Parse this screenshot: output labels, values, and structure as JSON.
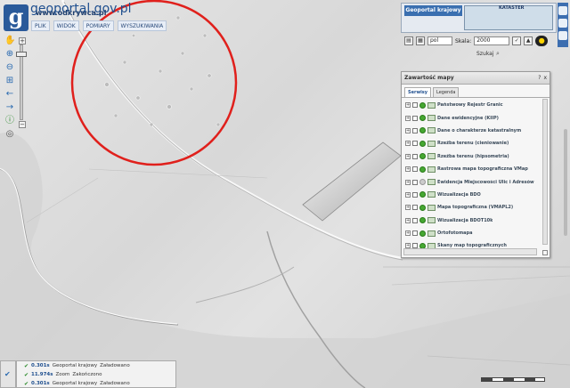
{
  "header": {
    "logo_letter": "g",
    "logo_text": "geoportal.gov.pl",
    "url_overlay": "www.odkrywca.pl",
    "portal_title": "Geoportal krajowy",
    "minimap_label": "KATASTER"
  },
  "menu": [
    "PLIK",
    "WIDOK",
    "POMIARY",
    "WYSZUKIWANIA"
  ],
  "toolbar": {
    "unit_value": "pol",
    "scale_label": "Skala:",
    "scale_value": "2000"
  },
  "search": {
    "label": "Szukaj"
  },
  "layers_panel": {
    "title": "Zawartość mapy",
    "header_buttons": [
      "?",
      "x"
    ],
    "tabs": [
      {
        "label": "Serwisy",
        "active": true
      },
      {
        "label": "Legenda",
        "active": false
      }
    ],
    "items": [
      {
        "label": "Państwowy Rejestr Granic",
        "visible": true
      },
      {
        "label": "Dane ewidencyjne (KIIP)",
        "visible": true
      },
      {
        "label": "Dane o charakterze katastralnym",
        "visible": true
      },
      {
        "label": "Rzeźba terenu (cieniowanie)",
        "visible": true
      },
      {
        "label": "Rzeźba terenu (hipsometria)",
        "visible": true
      },
      {
        "label": "Rastrowa mapa topograficzna VMap",
        "visible": true
      },
      {
        "label": "Ewidencja Miejscowości Ulic i Adresów",
        "visible": false
      },
      {
        "label": "Wizualizacja BDO",
        "visible": true
      },
      {
        "label": "Mapa topograficzna (VMAPL2)",
        "visible": true
      },
      {
        "label": "Wizualizacja BDOT10k",
        "visible": true
      },
      {
        "label": "Ortofotomapa",
        "visible": true
      },
      {
        "label": "Skany map topograficznych",
        "visible": true
      }
    ]
  },
  "status_log": [
    {
      "time": "0.301s",
      "label": "Geoportal krajowy",
      "state": "Załadowano"
    },
    {
      "time": "11.974s",
      "label": "Zoom",
      "state": "Zakończono"
    },
    {
      "time": "0.301s",
      "label": "Geoportal krajowy",
      "state": "Załadowano"
    }
  ],
  "colors": {
    "brand_blue": "#2a5a9a",
    "annotation_circle": "#e0201c",
    "layer_active": "#46a832"
  }
}
